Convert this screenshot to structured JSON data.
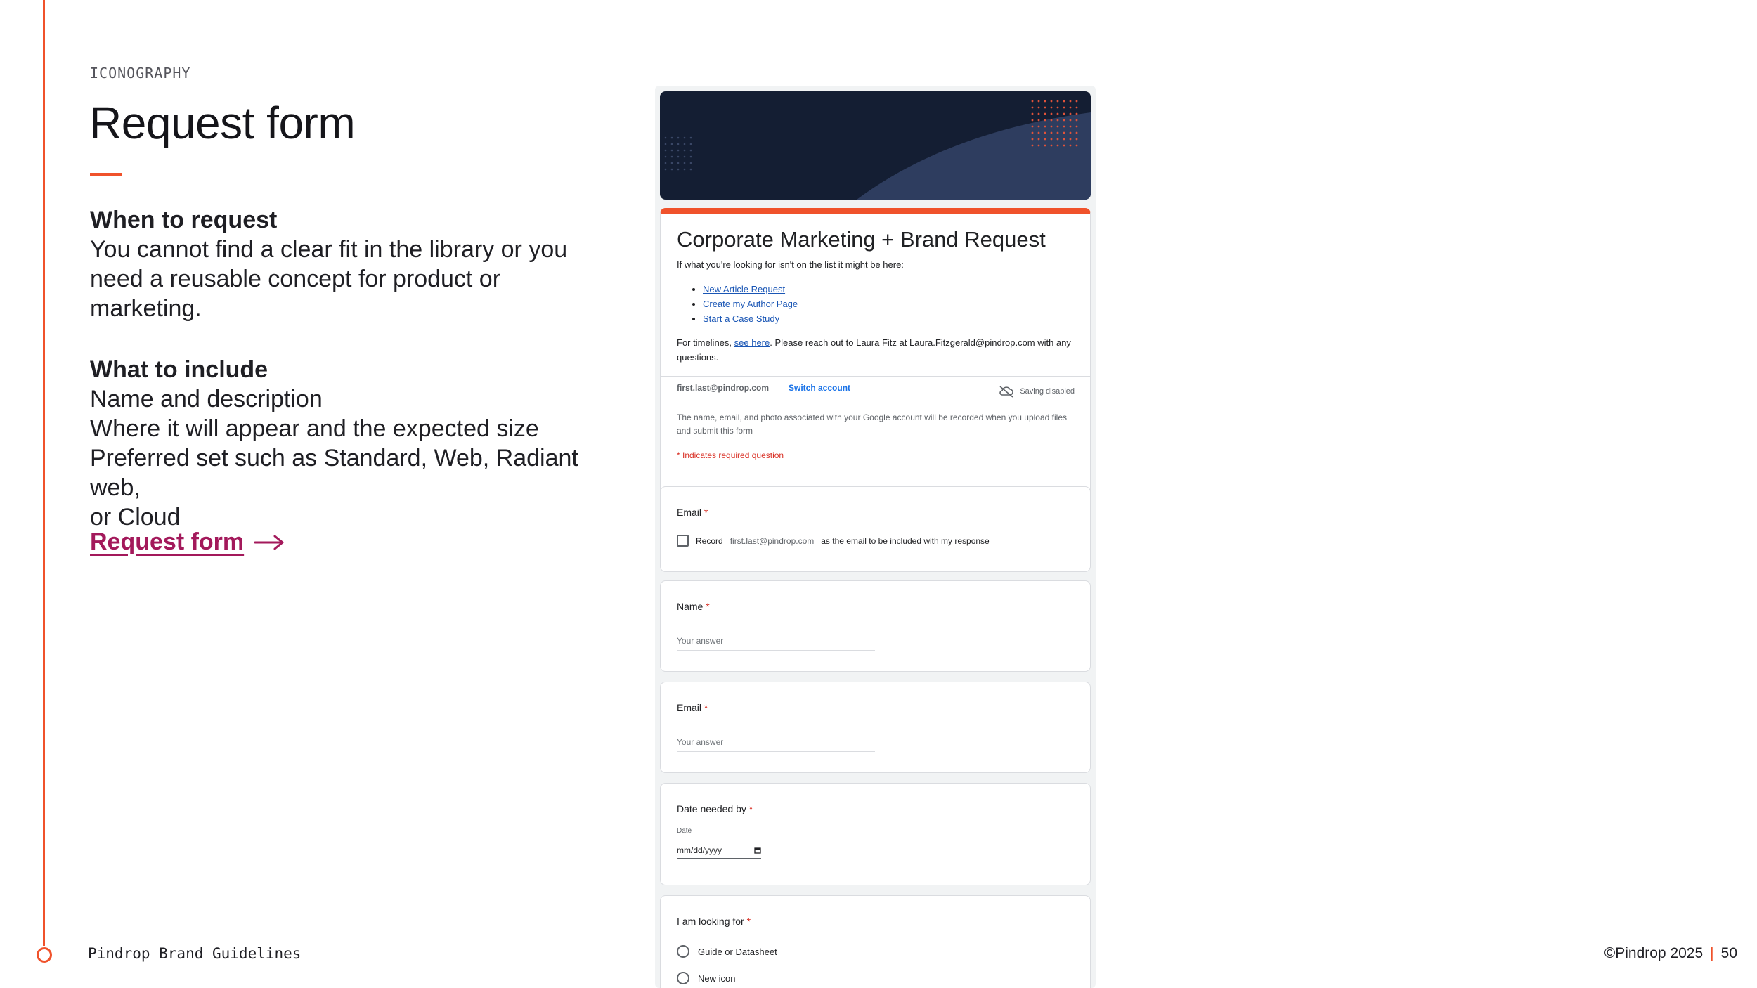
{
  "slide": {
    "eyebrow": "ICONOGRAPHY",
    "title": "Request form",
    "when": {
      "heading": "When to request",
      "lines": [
        "You cannot find a clear fit in the library or you",
        "need a reusable concept for product or",
        "marketing."
      ]
    },
    "what": {
      "heading": "What to include",
      "lines": [
        "Name and description",
        "Where it will appear and the expected size",
        "Preferred set such as Standard, Web, Radiant web,",
        "or Cloud"
      ]
    },
    "link_label": "Request form",
    "footer_left": "Pindrop Brand Guidelines",
    "footer_copyright": "©Pindrop 2025",
    "footer_sep": "|",
    "page_number": "50",
    "accent_color": "#f0522b",
    "link_color": "#a3195b"
  },
  "form": {
    "title": "Corporate Marketing + Brand Request",
    "intro": "If what you're looking for isn't on the list it might be here:",
    "links": [
      "New Article Request",
      "Create my Author Page",
      "Start a Case Study"
    ],
    "timeline_pre": "For timelines, ",
    "timeline_link": "see here",
    "timeline_post": ". Please reach out to Laura Fitz at Laura.Fitzgerald@pindrop.com with any questions.",
    "account": "first.last@pindrop.com",
    "switch_account": "Switch account",
    "saving": "Saving disabled",
    "notice": "The name, email, and photo associated with your Google account will be recorded when you upload files and submit this form",
    "required_note": "* Indicates required question",
    "star": "*",
    "q_email": "Email",
    "record_label": "Record",
    "record_email": "first.last@pindrop.com",
    "record_tail": "as the email to be included with my response",
    "q_name": "Name",
    "answer_placeholder": "Your answer",
    "q_email2": "Email",
    "q_date": "Date needed by",
    "date_sub": "Date",
    "date_placeholder": "mm/dd/yyyy",
    "q_looking": "I am looking for",
    "options": [
      "Guide or Datasheet",
      "New icon"
    ],
    "banner_color": "#141e33",
    "brand_red": "#f0522b"
  }
}
